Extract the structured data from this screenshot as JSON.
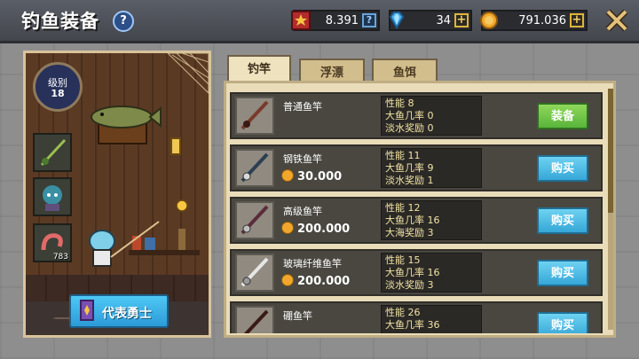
{
  "header": {
    "title": "钓鱼装备",
    "resources": {
      "ticket": "8.391",
      "gems": "34",
      "gold": "791.036"
    }
  },
  "hero": {
    "level_label": "级别",
    "level_value": "18",
    "bait_count": "783",
    "button_label": "代表勇士"
  },
  "tabs": [
    {
      "label": "钓竿",
      "active": true
    },
    {
      "label": "浮漂",
      "active": false
    },
    {
      "label": "鱼饵",
      "active": false
    }
  ],
  "rods": [
    {
      "name": "普通鱼竿",
      "price": "",
      "stats": [
        "性能 8",
        "大鱼几率 0",
        "淡水奖励 0"
      ],
      "action": "装备",
      "action_type": "equip"
    },
    {
      "name": "钢铁鱼竿",
      "price": "30.000",
      "stats": [
        "性能 11",
        "大鱼几率 9",
        "淡水奖励 1"
      ],
      "action": "购买",
      "action_type": "buy"
    },
    {
      "name": "高级鱼竿",
      "price": "200.000",
      "stats": [
        "性能 12",
        "大鱼几率 16",
        "大海奖励 3"
      ],
      "action": "购买",
      "action_type": "buy"
    },
    {
      "name": "玻璃纤维鱼竿",
      "price": "200.000",
      "stats": [
        "性能 15",
        "大鱼几率 16",
        "淡水奖励 3"
      ],
      "action": "购买",
      "action_type": "buy"
    },
    {
      "name": "硼鱼竿",
      "price": "",
      "stats": [
        "性能 26",
        "大鱼几率 36",
        ""
      ],
      "action": "购买",
      "action_type": "buy"
    }
  ],
  "colors": {
    "accent_buy": "#36a7d8",
    "accent_equip": "#58b53a",
    "gold": "#f0a72b"
  }
}
